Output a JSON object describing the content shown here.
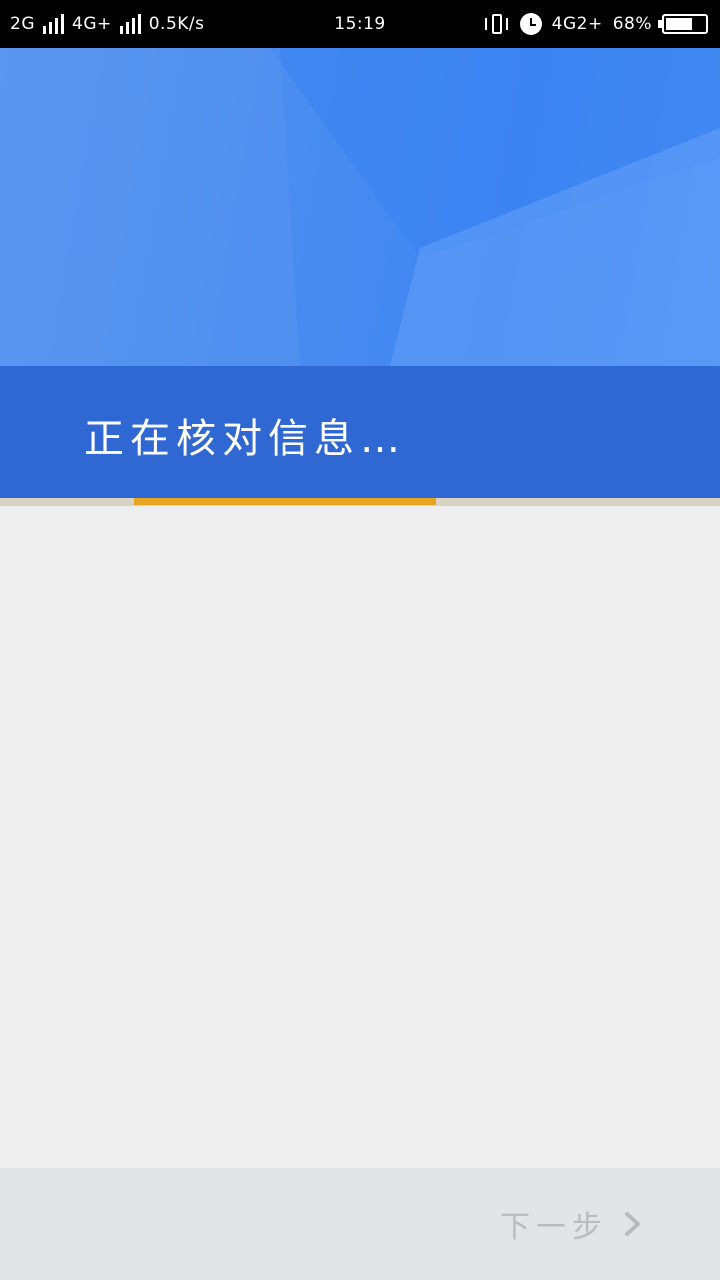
{
  "status_bar": {
    "network1": "2G",
    "network2": "4G+",
    "speed": "0.5K/s",
    "time": "15:19",
    "network3": "4G2+",
    "battery": "68%",
    "battery_level": 0.68
  },
  "banner": {
    "title": "正在核对信息…"
  },
  "progress": {
    "value": 0.42
  },
  "footer": {
    "next_label": "下一步"
  },
  "colors": {
    "banner": "#2f68d3",
    "accent": "#e6a521",
    "disabled_text": "#b9bcbe"
  }
}
